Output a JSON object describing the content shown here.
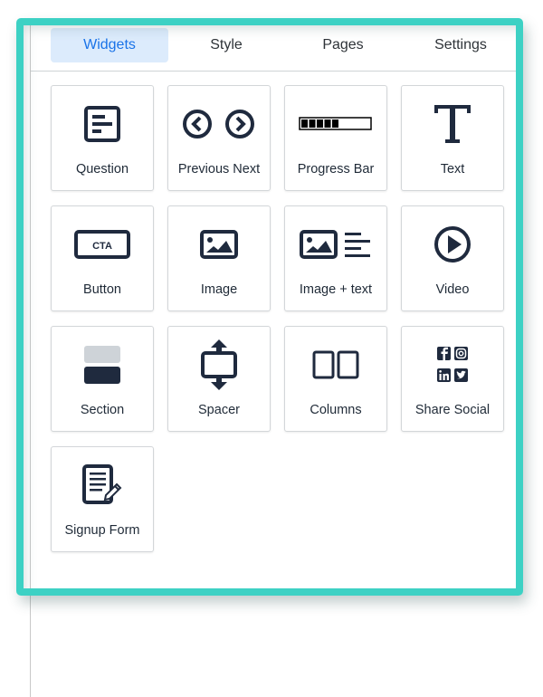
{
  "tabs": [
    {
      "label": "Widgets",
      "active": true
    },
    {
      "label": "Style",
      "active": false
    },
    {
      "label": "Pages",
      "active": false
    },
    {
      "label": "Settings",
      "active": false
    }
  ],
  "widgets": [
    {
      "label": "Question",
      "icon": "question-icon"
    },
    {
      "label": "Previous Next",
      "icon": "previous-next-icon"
    },
    {
      "label": "Progress Bar",
      "icon": "progress-bar-icon"
    },
    {
      "label": "Text",
      "icon": "text-icon"
    },
    {
      "label": "Button",
      "icon": "cta-button-icon",
      "icon_text": "CTA"
    },
    {
      "label": "Image",
      "icon": "image-icon"
    },
    {
      "label": "Image + text",
      "icon": "image-text-icon"
    },
    {
      "label": "Video",
      "icon": "play-icon"
    },
    {
      "label": "Section",
      "icon": "section-icon"
    },
    {
      "label": "Spacer",
      "icon": "spacer-icon"
    },
    {
      "label": "Columns",
      "icon": "columns-icon"
    },
    {
      "label": "Share Social",
      "icon": "social-icons"
    },
    {
      "label": "Signup Form",
      "icon": "signup-form-icon"
    }
  ],
  "progress_icon_fill": 0.55,
  "colors": {
    "frame": "#3dd1c4",
    "active_tab_bg": "#dcebfc",
    "active_tab_text": "#1a73e8",
    "icon": "#1f2a3e"
  }
}
